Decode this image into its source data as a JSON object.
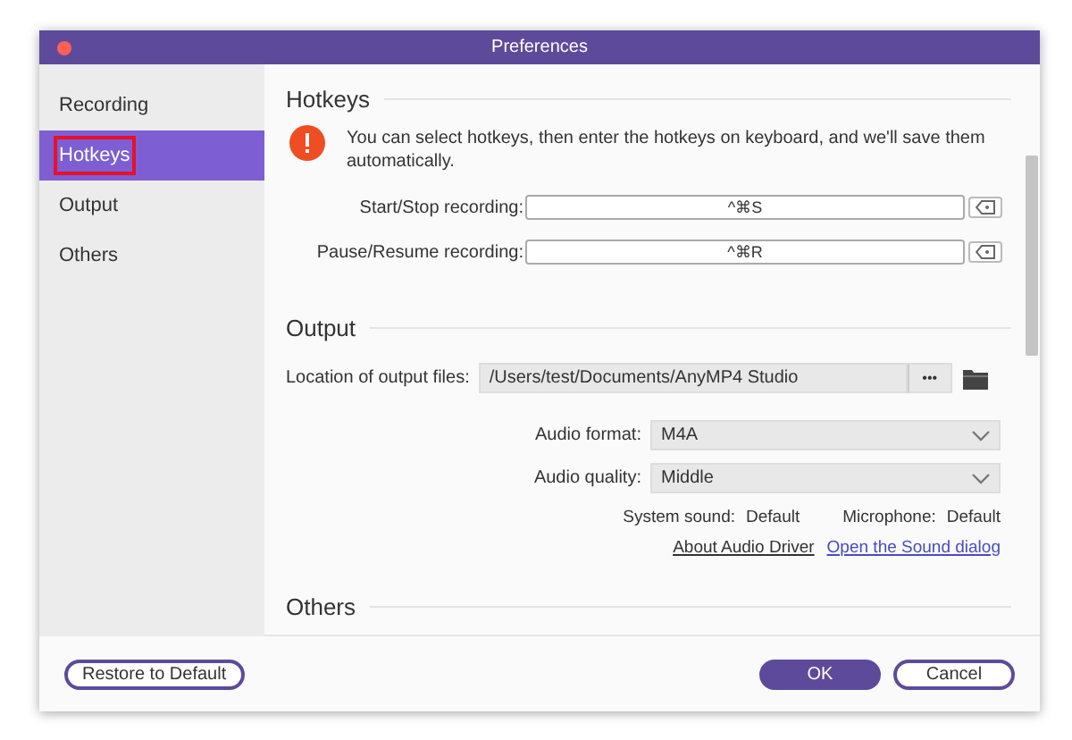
{
  "window": {
    "title": "Preferences"
  },
  "sidebar": {
    "items": [
      {
        "label": "Recording",
        "selected": false,
        "highlighted": false
      },
      {
        "label": "Hotkeys",
        "selected": true,
        "highlighted": true
      },
      {
        "label": "Output",
        "selected": false,
        "highlighted": false
      },
      {
        "label": "Others",
        "selected": false,
        "highlighted": false
      }
    ]
  },
  "hotkeys": {
    "heading": "Hotkeys",
    "notice": "You can select hotkeys, then enter the hotkeys on keyboard, and we'll save them automatically.",
    "rows": [
      {
        "label": "Start/Stop recording:",
        "value": "^⌘S"
      },
      {
        "label": "Pause/Resume recording:",
        "value": "^⌘R"
      }
    ]
  },
  "output": {
    "heading": "Output",
    "location_label": "Location of output files:",
    "location_value": "/Users/test/Documents/AnyMP4 Studio",
    "browse_button": "•••",
    "dropdowns": [
      {
        "label": "Audio format:",
        "value": "M4A"
      },
      {
        "label": "Audio quality:",
        "value": "Middle"
      }
    ],
    "system_sound_label": "System sound:",
    "system_sound_value": "Default",
    "microphone_label": "Microphone:",
    "microphone_value": "Default",
    "links": [
      "About Audio Driver",
      "Open the Sound dialog"
    ]
  },
  "others": {
    "heading": "Others"
  },
  "footer": {
    "restore_button": "Restore to Default",
    "ok_button": "OK",
    "cancel_button": "Cancel"
  }
}
